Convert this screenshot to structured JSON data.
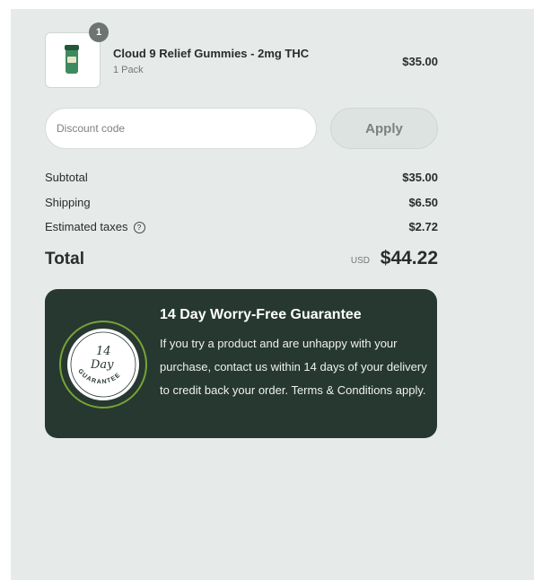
{
  "cart": {
    "item": {
      "name": "Cloud 9 Relief Gummies - 2mg THC",
      "variant": "1 Pack",
      "price": "$35.00",
      "quantity": "1"
    },
    "discount": {
      "placeholder": "Discount code",
      "apply_label": "Apply"
    },
    "summary": {
      "subtotal_label": "Subtotal",
      "subtotal_value": "$35.00",
      "shipping_label": "Shipping",
      "shipping_value": "$6.50",
      "taxes_label": "Estimated taxes",
      "taxes_value": "$2.72",
      "total_label": "Total",
      "total_currency": "USD",
      "total_value": "$44.22"
    }
  },
  "guarantee": {
    "title": "14 Day Worry-Free Guarantee",
    "body": "If you try a product and are unhappy with your purchase, contact us within 14 days of your delivery to credit back your order. Terms & Conditions apply.",
    "seal_text": "14 Day GUARANTEE"
  },
  "icons": {
    "help": "question-circle-icon"
  },
  "colors": {
    "panel_background": "#e6ebea",
    "guarantee_background": "#263830",
    "seal_ring": "#7aa236"
  }
}
